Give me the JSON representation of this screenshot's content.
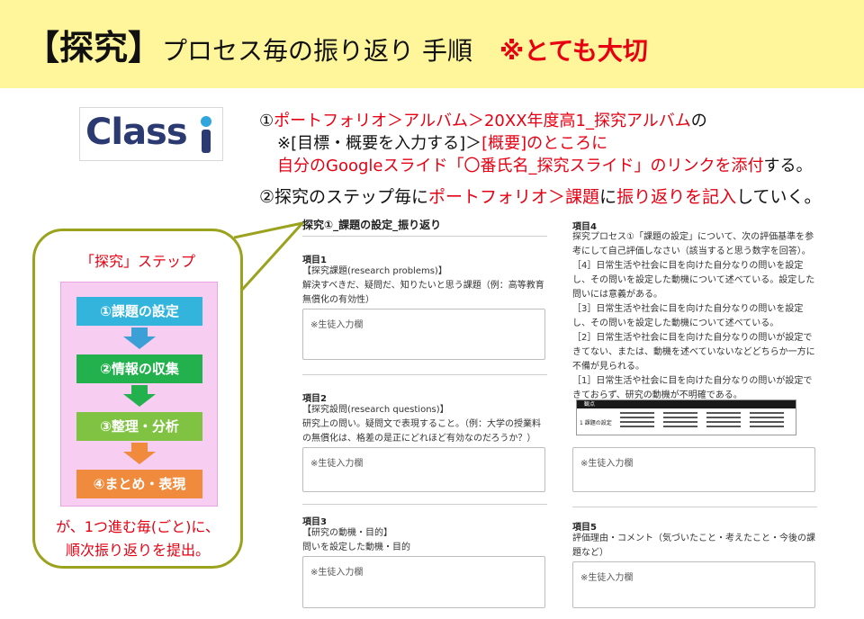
{
  "title": {
    "bracket_open": "【",
    "bracket_word": "探究",
    "bracket_close": "】",
    "main": "プロセス毎の振り返り 手順",
    "important": "※とても大切"
  },
  "logo": {
    "text": "Classi",
    "icon": "classi-logo"
  },
  "instructions": {
    "line1_pre": "①",
    "line1_red": "ポートフォリオ＞アルバム＞20XX年度高1_探究アルバム",
    "line1_post": "の",
    "line2_pre": "※[目標・概要を入力する]＞",
    "line2_red": "[概要]のところに",
    "line3_red": "自分のGoogleスライド「〇番氏名_探究スライド」のリンクを添付",
    "line3_post": "する。",
    "line4_pre": "②探究のステップ毎に",
    "line4_red1": "ポートフォリオ＞課題",
    "line4_mid": "に",
    "line4_red2": "振り返りを記入",
    "line4_post": "していく。"
  },
  "steps_panel": {
    "title": "「探究」ステップ",
    "steps": [
      "①課題の設定",
      "②情報の収集",
      "③整理・分析",
      "④まとめ・表現"
    ],
    "note_line1": "が、1つ進む毎(ごと)に、",
    "note_line2": "順次振り返りを提出。",
    "colors": {
      "step1": "#33b4dd",
      "step2": "#22b14c",
      "step3": "#80c342",
      "step4": "#f08a3c",
      "accent": "#e60012"
    }
  },
  "form": {
    "heading": "探究①_課題の設定_振り返り",
    "item1": {
      "label": "項目1",
      "line1": "【探究課題(research problems)】",
      "line2": "解決すべきだ、疑問だ、知りたいと思う課題（例：高等教育",
      "line3": "無償化の有効性）",
      "placeholder": "※生徒入力欄"
    },
    "item2": {
      "label": "項目2",
      "line1": "【探究設問(research questions)】",
      "line2": "研究上の問い。疑問文で表現すること。（例：大学の授業料",
      "line3": "の無償化は、格差の是正にどれほど有効なのだろうか？）",
      "placeholder": "※生徒入力欄"
    },
    "item3": {
      "label": "項目3",
      "line1": "【研究の動機・目的】",
      "line2": "問いを設定した動機・目的",
      "placeholder": "※生徒入力欄"
    },
    "item4": {
      "label": "項目4",
      "lines": [
        "探究プロセス①「課題の設定」について、次の評価基準を参",
        "考にして自己評価しなさい（該当すると思う数字を回答）。",
        "［4］日常生活や社会に目を向けた自分なりの問いを設定",
        "し、その問いを設定した動機について述べている。設定した",
        "問いには意義がある。",
        "［3］日常生活や社会に目を向けた自分なりの問いを設定",
        "し、その問いを設定した動機について述べている。",
        "［2］日常生活や社会に目を向けた自分なりの問いが設定で",
        "きてない、または、動機を述べていないなどどちらか一方に",
        "不備が見られる。",
        "［1］日常生活や社会に目を向けた自分なりの問いが設定で",
        "きておらず、研究の動機が不明確である。"
      ],
      "rubric_header": "観点",
      "rubric_row": "1 課題の設定",
      "placeholder": "※生徒入力欄"
    },
    "item5": {
      "label": "項目5",
      "line1": "評価理由・コメント（気づいたこと・考えたこと・今後の課",
      "line2": "題など）",
      "placeholder": "※生徒入力欄"
    }
  }
}
